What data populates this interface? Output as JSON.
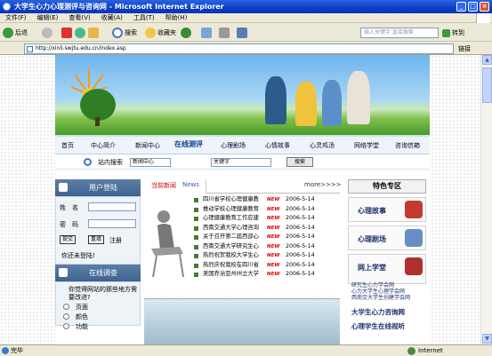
{
  "window": {
    "title": "大学生心力心理测评与咨询网 - Microsoft Internet Explorer",
    "min": "_",
    "max": "□",
    "close": "×"
  },
  "menu": [
    "文件(F)",
    "编辑(E)",
    "查看(V)",
    "收藏(A)",
    "工具(T)",
    "帮助(H)"
  ],
  "toolbar": {
    "back": "后退",
    "search": "搜索",
    "favorites": "收藏夹",
    "search_placeholder": "输入关键字 直接搜索",
    "goto": "转到",
    "links": "链接"
  },
  "address": {
    "url": "http://xinli.swjtu.edu.cn/index.asp"
  },
  "nav": {
    "items": [
      "首页",
      "中心简介",
      "新闻中心",
      "在线测评",
      "心理剧场",
      "心情故事",
      "心灵鸡汤",
      "网络学堂",
      "咨询信箱"
    ],
    "active_index": 3
  },
  "sitesearch": {
    "label": "站内搜索",
    "scope": "新闻中心",
    "keyword": "关键字",
    "button": "搜索"
  },
  "login": {
    "title": "用户登陆",
    "name_label": "姓　名",
    "pwd_label": "密　码",
    "submit": "提交",
    "reset": "重填",
    "register": "注册",
    "not_logged": "你还未登陆!"
  },
  "poll": {
    "title": "在线调查",
    "question": "你觉得网站的那些地方需要改进?",
    "options": [
      "页面",
      "颜色",
      "功能"
    ]
  },
  "news": {
    "tab_cn": "当前新闻",
    "tab_en": "News",
    "more": "more>>>>",
    "new_badge": "NEW",
    "items": [
      {
        "title": "四川省学校心理健康教",
        "date": "2006-5-14"
      },
      {
        "title": "推动学校心理健康教育",
        "date": "2006-5-14"
      },
      {
        "title": "心理健康教育工作应建",
        "date": "2006-5-14"
      },
      {
        "title": "西南交通大学心理咨询",
        "date": "2006-5-14"
      },
      {
        "title": "关于召开第二届西部心",
        "date": "2006-5-14"
      },
      {
        "title": "西南交通大学研究生心",
        "date": "2006-5-14"
      },
      {
        "title": "热烈祝贺我校大学生心",
        "date": "2006-5-14"
      },
      {
        "title": "热烈庆祝我校在四川省",
        "date": "2006-5-14"
      },
      {
        "title": "美国乔治亚州州立大学",
        "date": "2006-5-14"
      }
    ]
  },
  "special": {
    "title": "特色专区",
    "features": [
      "心理故事",
      "心理剧场",
      "网上学堂"
    ],
    "links": [
      "研究生心力学会网",
      "心力大学生心理学会网",
      "西南交大学生创建学会网"
    ],
    "big1": "大学生心力咨询网",
    "big2": "心理学生在线视听"
  },
  "status": {
    "done": "完毕",
    "zone": "Internet"
  },
  "colors": {
    "titlebar": "#0a3ec8",
    "nav_active": "#0b3e8c",
    "news_red": "#d00"
  }
}
